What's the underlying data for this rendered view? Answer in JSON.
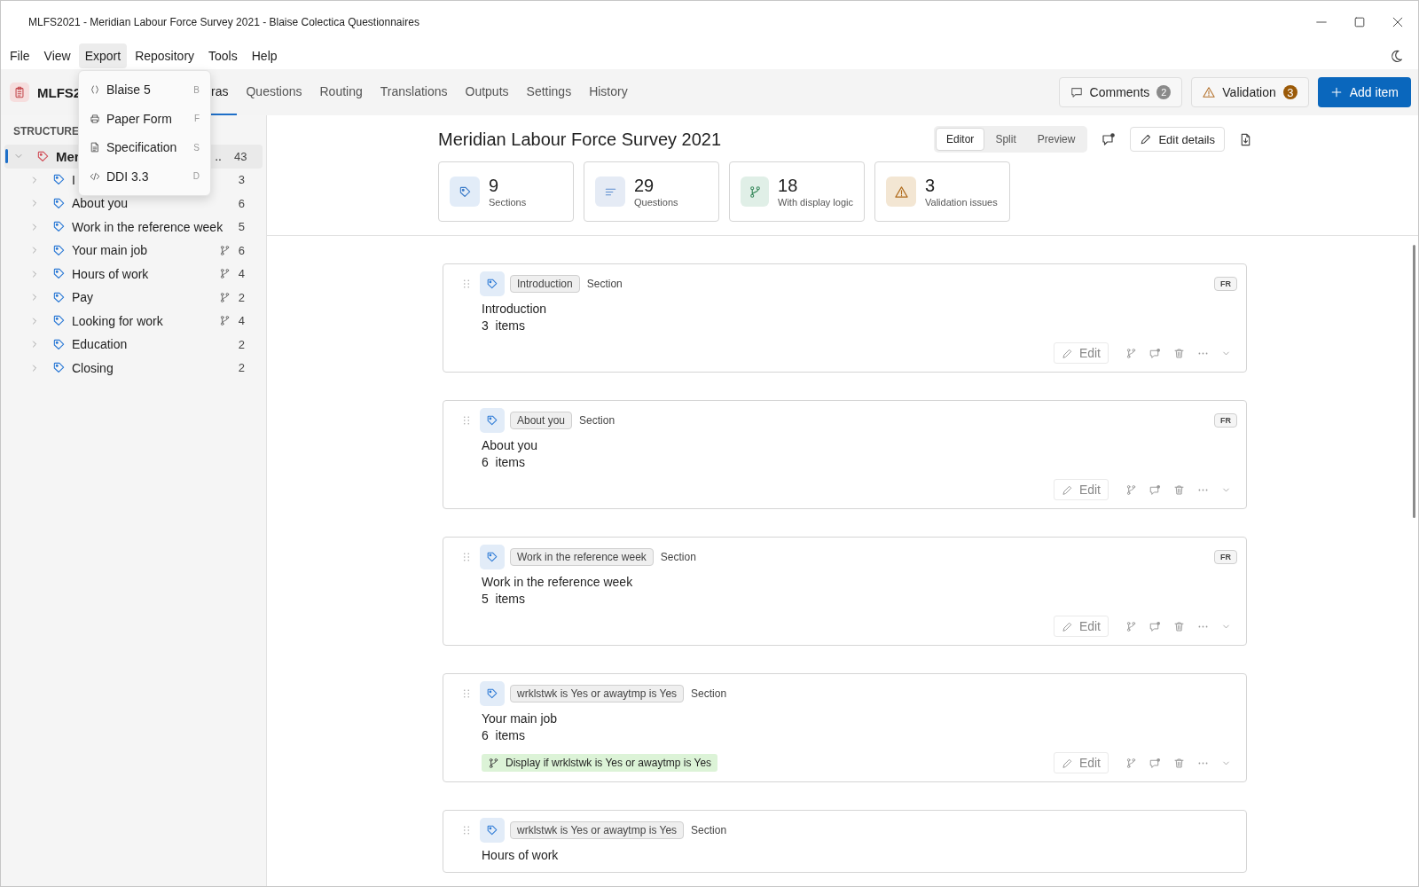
{
  "window": {
    "title": "MLFS2021 - Meridian Labour Force Survey 2021 - Blaise Colectica Questionnaires"
  },
  "menu": [
    {
      "label": "File",
      "selected": false
    },
    {
      "label": "View",
      "selected": false
    },
    {
      "label": "Export",
      "selected": true
    },
    {
      "label": "Repository",
      "selected": false
    },
    {
      "label": "Tools",
      "selected": false
    },
    {
      "label": "Help",
      "selected": false
    }
  ],
  "export_menu": [
    {
      "kind": "braces",
      "label": "Blaise 5",
      "shortcut": "B"
    },
    {
      "kind": "printer",
      "label": "Paper Form",
      "shortcut": "F"
    },
    {
      "kind": "document",
      "label": "Specification",
      "shortcut": "S"
    },
    {
      "kind": "code",
      "label": "DDI 3.3",
      "shortcut": "D"
    }
  ],
  "toolbar": {
    "project": "MLFS2",
    "tabs": [
      {
        "label": "ras",
        "selected": true
      },
      {
        "label": "Questions",
        "selected": false
      },
      {
        "label": "Routing",
        "selected": false
      },
      {
        "label": "Translations",
        "selected": false
      },
      {
        "label": "Outputs",
        "selected": false
      },
      {
        "label": "Settings",
        "selected": false
      },
      {
        "label": "History",
        "selected": false
      }
    ],
    "comments": {
      "label": "Comments",
      "count": "2"
    },
    "validation": {
      "label": "Validation",
      "count": "3"
    },
    "add_button": "Add item"
  },
  "sidebar": {
    "heading": "STRUCTURE",
    "root": {
      "label": "Mer",
      "tail": "..",
      "count": "43",
      "expanded": true,
      "selected": true,
      "children": [
        {
          "label": "I",
          "count": "3",
          "has_logic": false,
          "expanded": false
        },
        {
          "label": "About you",
          "count": "6",
          "has_logic": false,
          "expanded": false
        },
        {
          "label": "Work in the reference week",
          "count": "5",
          "has_logic": false,
          "expanded": false
        },
        {
          "label": "Your main job",
          "count": "6",
          "has_logic": true,
          "expanded": false
        },
        {
          "label": "Hours of work",
          "count": "4",
          "has_logic": true,
          "expanded": false
        },
        {
          "label": "Pay",
          "count": "2",
          "has_logic": true,
          "expanded": false
        },
        {
          "label": "Looking for work",
          "count": "4",
          "has_logic": true,
          "expanded": false
        },
        {
          "label": "Education",
          "count": "2",
          "has_logic": false,
          "expanded": false
        },
        {
          "label": "Closing",
          "count": "2",
          "has_logic": false,
          "expanded": false
        }
      ]
    }
  },
  "editor": {
    "title": "Meridian Labour Force Survey 2021",
    "view_modes": [
      {
        "label": "Editor",
        "selected": true
      },
      {
        "label": "Split",
        "selected": false
      },
      {
        "label": "Preview",
        "selected": false
      }
    ],
    "edit_details": "Edit details",
    "stats": [
      {
        "kind": "sections",
        "value": "9",
        "label": "Sections"
      },
      {
        "kind": "questions",
        "value": "29",
        "label": "Questions"
      },
      {
        "kind": "logic",
        "value": "18",
        "label": "With display logic"
      },
      {
        "kind": "validation",
        "value": "3",
        "label": "Validation issues"
      }
    ],
    "cards": [
      {
        "chip": "Introduction",
        "type": "Section",
        "title": "Introduction",
        "items": "3  items",
        "language": "FR",
        "edit": "Edit"
      },
      {
        "chip": "About you",
        "type": "Section",
        "title": "About you",
        "items": "6  items",
        "language": "FR",
        "edit": "Edit"
      },
      {
        "chip": "Work in the reference week",
        "type": "Section",
        "title": "Work in the reference week",
        "items": "5  items",
        "language": "FR",
        "edit": "Edit"
      },
      {
        "chip": "wrklstwk is Yes or awaytmp is Yes",
        "type": "Section",
        "title": "Your main job",
        "items": "6  items",
        "display_logic": "Display if wrklstwk is Yes or awaytmp is Yes",
        "edit": "Edit"
      },
      {
        "chip": "wrklstwk is Yes or awaytmp is Yes",
        "type": "Section",
        "title": "Hours of work"
      }
    ]
  }
}
